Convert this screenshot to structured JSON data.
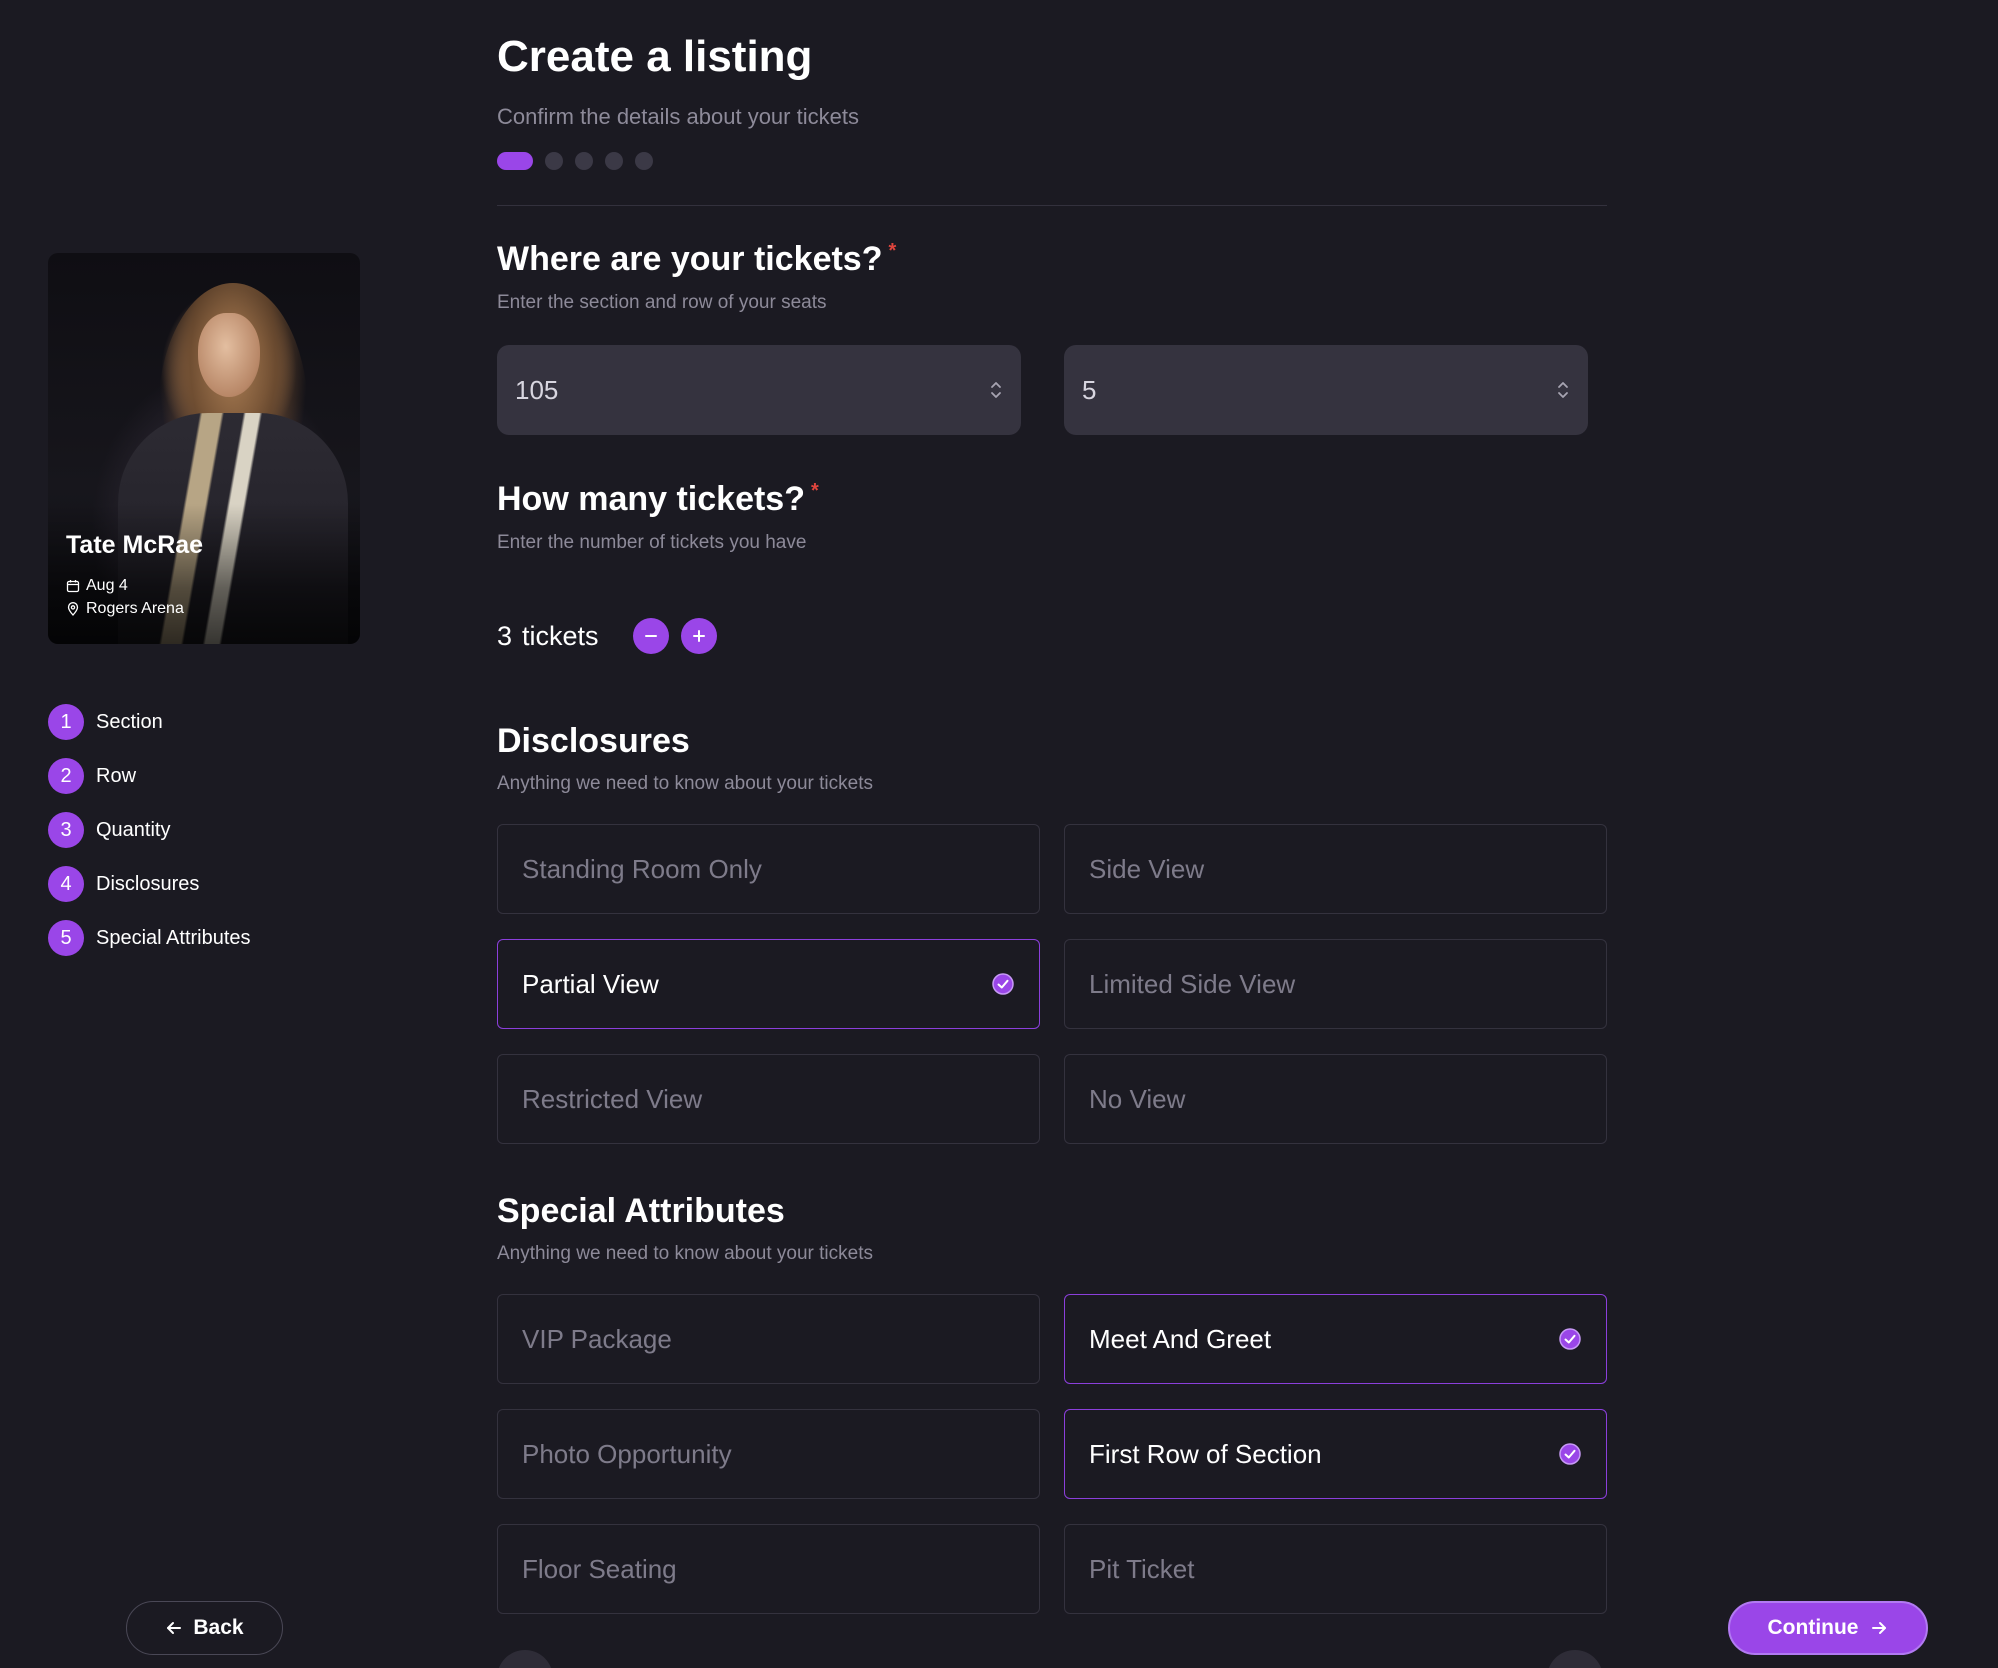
{
  "page": {
    "title": "Create a listing",
    "subtitle": "Confirm the details about your tickets",
    "progress": {
      "current_step": 1,
      "total_steps": 5
    }
  },
  "event": {
    "artist": "Tate McRae",
    "date": "Aug 4",
    "venue": "Rogers Arena"
  },
  "steps": [
    {
      "num": "1",
      "label": "Section"
    },
    {
      "num": "2",
      "label": "Row"
    },
    {
      "num": "3",
      "label": "Quantity"
    },
    {
      "num": "4",
      "label": "Disclosures"
    },
    {
      "num": "5",
      "label": "Special Attributes"
    }
  ],
  "where": {
    "title": "Where are your tickets?",
    "required_mark": "*",
    "subtitle": "Enter the section and row of your seats",
    "section_value": "105",
    "row_value": "5"
  },
  "quantity": {
    "title": "How many tickets?",
    "required_mark": "*",
    "subtitle": "Enter the number of tickets you have",
    "count": "3",
    "unit": "tickets"
  },
  "disclosures": {
    "title": "Disclosures",
    "subtitle": "Anything we need to know about your tickets",
    "options": [
      {
        "label": "Standing Room Only",
        "selected": false
      },
      {
        "label": "Side View",
        "selected": false
      },
      {
        "label": "Partial View",
        "selected": true
      },
      {
        "label": "Limited Side View",
        "selected": false
      },
      {
        "label": "Restricted View",
        "selected": false
      },
      {
        "label": "No View",
        "selected": false
      }
    ]
  },
  "special_attributes": {
    "title": "Special Attributes",
    "subtitle": "Anything we need to know about your tickets",
    "options": [
      {
        "label": "VIP Package",
        "selected": false
      },
      {
        "label": "Meet And Greet",
        "selected": true
      },
      {
        "label": "Photo Opportunity",
        "selected": false
      },
      {
        "label": "First Row of Section",
        "selected": true
      },
      {
        "label": "Floor Seating",
        "selected": false
      },
      {
        "label": "Pit Ticket",
        "selected": false
      }
    ]
  },
  "footer": {
    "back_label": "Back",
    "continue_label": "Continue"
  },
  "colors": {
    "background": "#1b1a22",
    "accent": "#9a46e8",
    "required": "#e0453d",
    "muted_text": "#8d8a99",
    "input_bg": "#35333f"
  },
  "icons": {
    "date": "calendar-icon",
    "venue": "location-pin-icon",
    "select": "chevron-updown-icon",
    "minus": "minus-icon",
    "plus": "plus-icon",
    "selected": "check-circle-icon",
    "back": "arrow-left-icon",
    "continue": "arrow-right-icon"
  }
}
